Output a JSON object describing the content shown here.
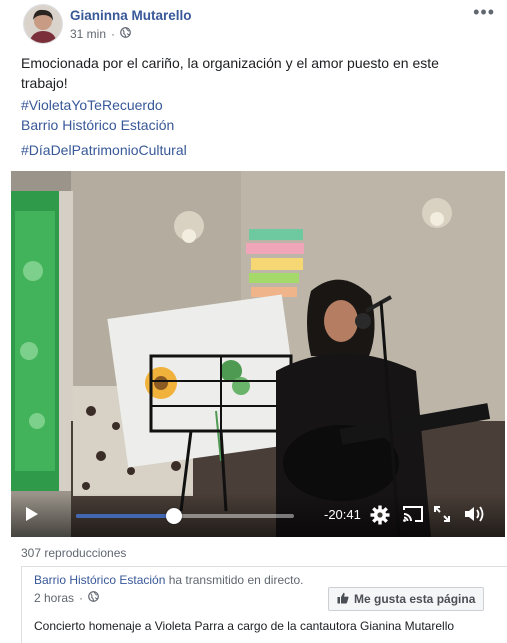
{
  "post": {
    "author": "Gianinna Mutarello",
    "time": "31 min",
    "privacy_icon": "globe-icon",
    "text": "Emocionada por el cariño, la organización y el amor puesto en este trabajo!",
    "hashtag1": "#VioletaYoTeRecuerdo",
    "mention": "Barrio Histórico Estación",
    "hashtag2": "#DíaDelPatrimonioCultural"
  },
  "video": {
    "remaining_time": "-20:41",
    "progress": 0.45,
    "colors": {
      "progress": "#4267b2"
    }
  },
  "views": "307 reproducciones",
  "shared": {
    "page_name": "Barrio Histórico Estación",
    "action": "ha transmitido en directo.",
    "time": "2 horas",
    "like_button": "Me gusta esta página",
    "description": "Concierto homenaje a Violeta Parra a cargo de la cantautora Gianina Mutarello"
  },
  "colors": {
    "link": "#385898",
    "text": "#1c1e21",
    "muted": "#606770"
  }
}
